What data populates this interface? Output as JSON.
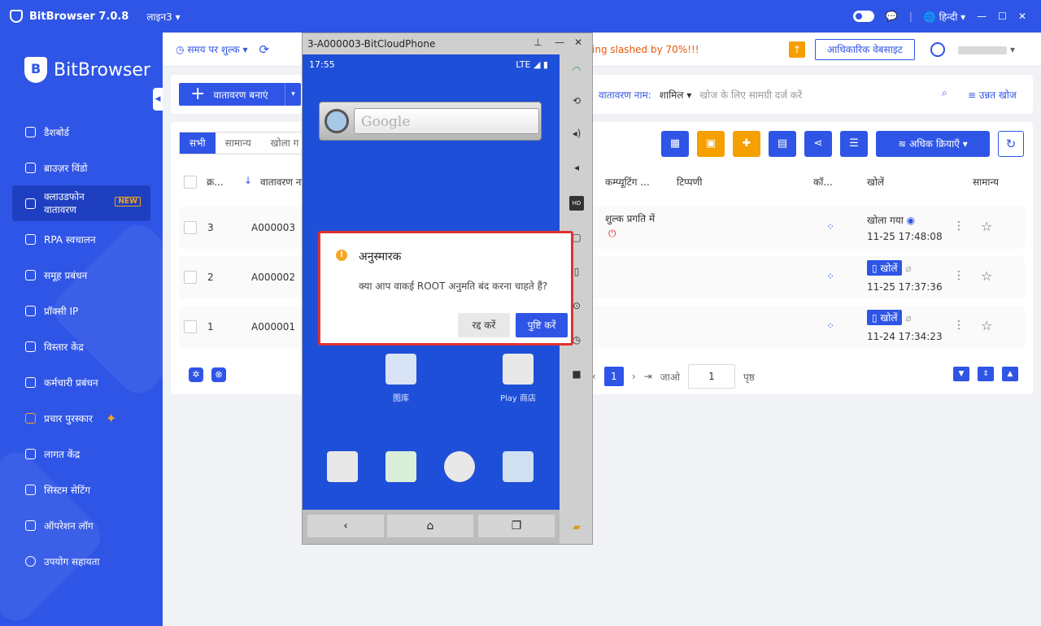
{
  "titlebar": {
    "app_name": "BitBrowser 7.0.8",
    "line": "लाइन3",
    "language": "हिन्दी"
  },
  "sidebar": {
    "brand": "BitBrowser",
    "items": [
      {
        "label": "डैशबोर्ड"
      },
      {
        "label": "ब्राउज़र विंडो"
      },
      {
        "label": "क्लाउडफोन वातावरण",
        "badge": "NEW"
      },
      {
        "label": "RPA स्वचालन"
      },
      {
        "label": "समूह प्रबंधन"
      },
      {
        "label": "प्रॉक्सी IP"
      },
      {
        "label": "विस्तार केंद्र"
      },
      {
        "label": "कर्मचारी प्रबंधन"
      },
      {
        "label": "प्रचार पुरस्कार"
      },
      {
        "label": "लागत केंद्र"
      },
      {
        "label": "सिस्टम सेटिंग"
      },
      {
        "label": "ऑपरेशन लॉग"
      },
      {
        "label": "उपयोग सहायता"
      }
    ]
  },
  "topbar": {
    "time_fee": "समय पर शुल्क",
    "marquee": "ing slashed by 70%!!!",
    "official": "आधिकारिक वेबसाइट"
  },
  "toolbar": {
    "create": "वातावरण बनाएं",
    "search_label": "वातावरण नाम:",
    "search_mode": "शामिल",
    "search_placeholder": "खोज के लिए सामग्री दर्ज करें",
    "advanced": "उन्नत खोज"
  },
  "tabs": [
    "सभी",
    "सामान्य",
    "खोला ग"
  ],
  "more_actions": "अधिक क्रियाएँ",
  "table": {
    "headers": {
      "serial": "क्र...",
      "name": "वातावरण ना",
      "computing": "कम्प्यूटिंग ...",
      "note": "टिप्पणी",
      "config": "कॉ...",
      "open": "खोलें",
      "normal": "सामान्य"
    },
    "rows": [
      {
        "serial": "3",
        "name": "A000003",
        "status": "शुल्क प्रगति में",
        "open_state": "खोला गया",
        "time": "11-25 17:48:08"
      },
      {
        "serial": "2",
        "name": "A000002",
        "status": "",
        "open_state": "खोलें",
        "time": "11-25 17:37:36"
      },
      {
        "serial": "1",
        "name": "A000001",
        "status": "",
        "open_state": "खोलें",
        "time": "11-24 17:34:23"
      }
    ]
  },
  "pager": {
    "current": "1",
    "goto": "जाओ",
    "input": "1",
    "page": "पृष्ठ"
  },
  "phone": {
    "title": "3-A000003-BitCloudPhone",
    "time": "17:55",
    "net": "LTE",
    "search": "Google",
    "apps": [
      {
        "label": "图库"
      },
      {
        "label": "Play 商店"
      }
    ]
  },
  "dialog": {
    "title": "अनुस्मारक",
    "message": "क्या आप वाकई ROOT अनुमति बंद करना चाहते हैं?",
    "cancel": "रद्द करें",
    "confirm": "पुष्टि करें"
  },
  "colors": {
    "primary": "#2f55e6",
    "warning": "#f59f00",
    "danger": "#e03131"
  }
}
